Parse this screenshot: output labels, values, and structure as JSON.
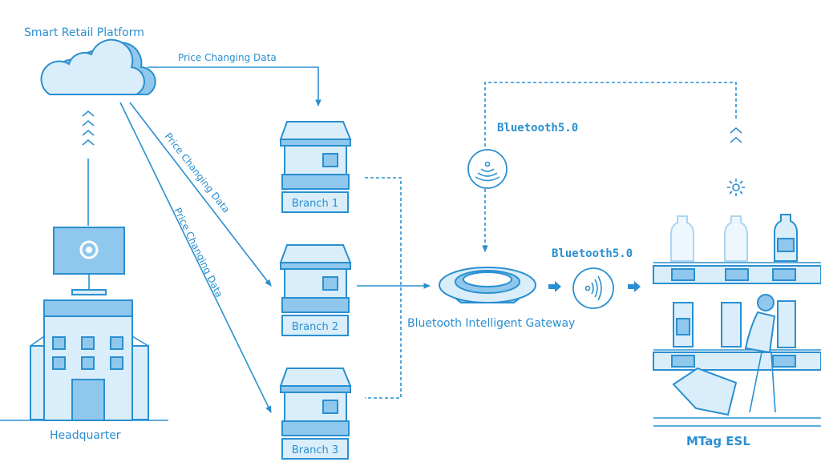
{
  "colors": {
    "accent": "#2a8fd0",
    "light_fill": "#d9eefa",
    "mid_fill": "#8fc8ec"
  },
  "platform": {
    "label": "Smart Retail Platform",
    "icon": "cloud-icon"
  },
  "links": {
    "top": "Price Changing Data",
    "diag1": "Price Changing Data",
    "diag2": "Price Changing Data"
  },
  "headquarter": {
    "label": "Headquarter",
    "icons": [
      "monitor-gear-icon",
      "building-icon"
    ]
  },
  "branches": [
    {
      "label": "Branch 1"
    },
    {
      "label": "Branch 2"
    },
    {
      "label": "Branch 3"
    }
  ],
  "gateway": {
    "label": "Bluetooth Intelligent Gateway",
    "icon": "gateway-icon"
  },
  "bluetooth": {
    "top": "Bluetooth5.0",
    "right": "Bluetooth5.0"
  },
  "esl": {
    "label": "MTag ESL",
    "icon": "shelf-shopper-icon"
  }
}
